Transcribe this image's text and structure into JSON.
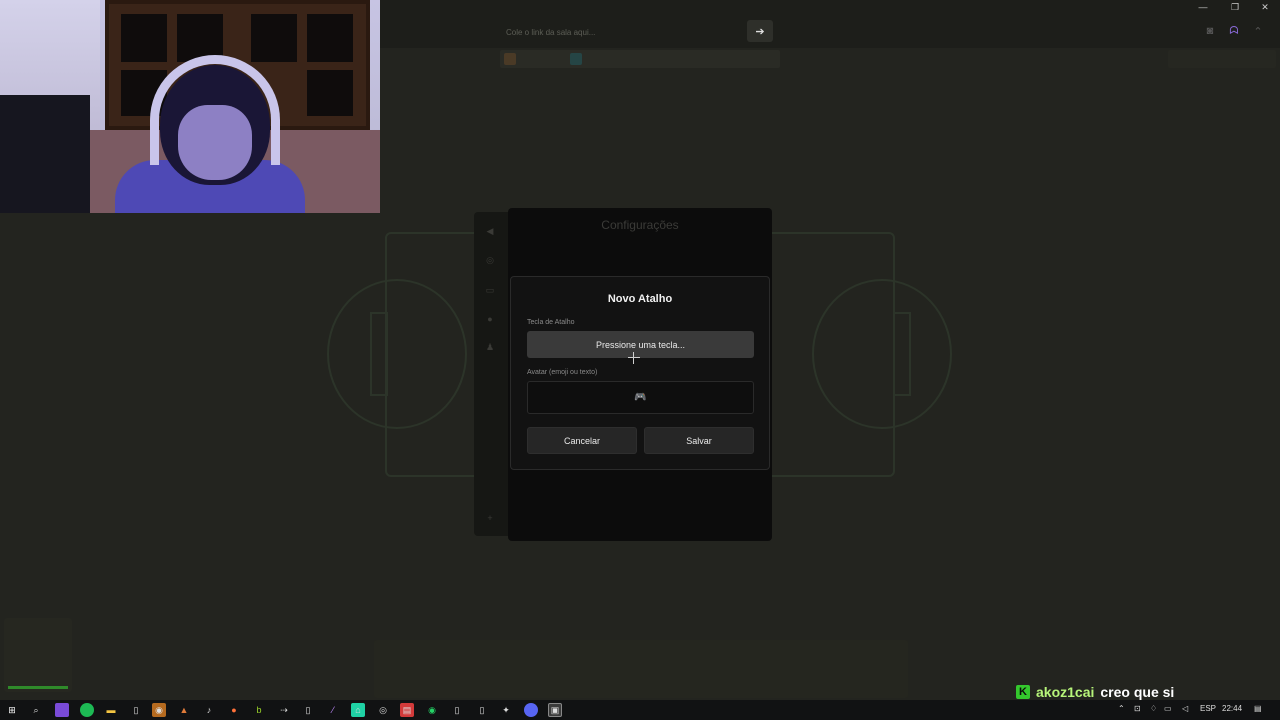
{
  "topbar": {
    "link_placeholder": "Cole o link da sala aqui...",
    "go_icon": "arrow-right-icon",
    "window_controls": [
      "minimize",
      "restore",
      "close"
    ]
  },
  "settings": {
    "title": "Configurações"
  },
  "modal": {
    "title": "Novo Atalho",
    "key_label": "Tecla de Atalho",
    "key_prompt": "Pressione uma tecla...",
    "avatar_label": "Avatar (emoji ou texto)",
    "avatar_value": "🎮",
    "cancel_label": "Cancelar",
    "save_label": "Salvar"
  },
  "chat_overlay": {
    "platform_icon": "K",
    "username": "akoz1cai",
    "message": "creo que si",
    "colors": {
      "badge": "#34c82d",
      "username": "#b7f57a"
    }
  },
  "taskbar": {
    "language": "ESP",
    "time": "22:44"
  }
}
